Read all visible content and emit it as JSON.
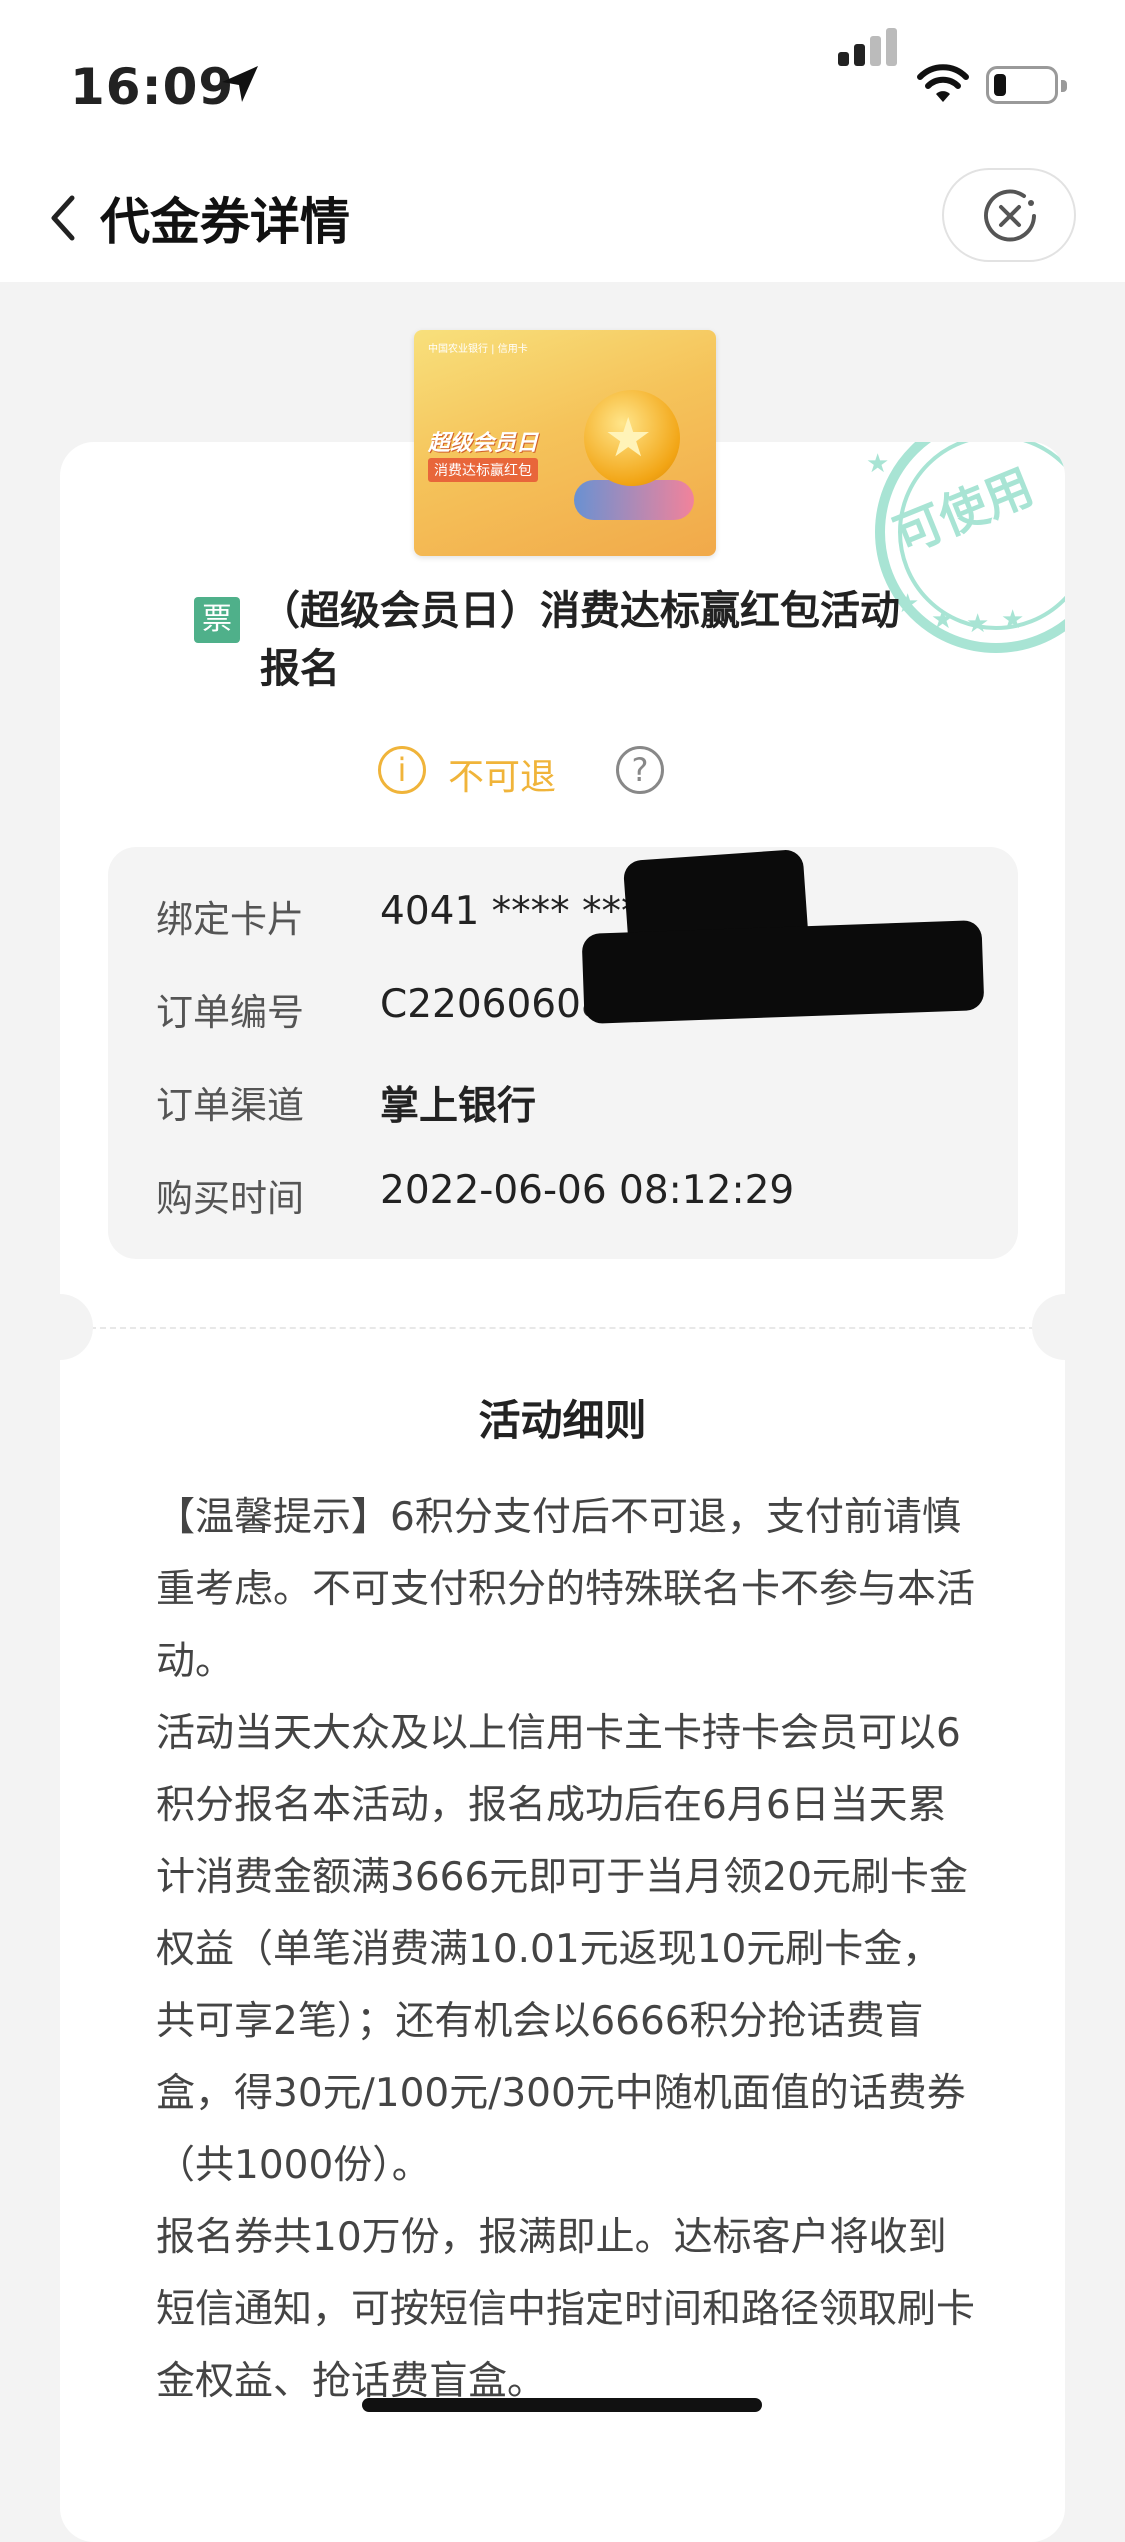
{
  "status": {
    "time": "16:09"
  },
  "nav": {
    "title": "代金券详情"
  },
  "voucher": {
    "stamp_text": "可使用",
    "image": {
      "bank_text": "中国农业银行 | 信用卡",
      "title": "超级会员日",
      "subtitle": "消费达标赢红包"
    },
    "tag": "票",
    "title": "（超级会员日）消费达标赢红包活动报名",
    "refund_text": "不可退"
  },
  "details": [
    {
      "label": "绑定卡片",
      "value": "4041 **** ****"
    },
    {
      "label": "订单编号",
      "value": "C22060608"
    },
    {
      "label": "订单渠道",
      "value": "掌上银行"
    },
    {
      "label": "购买时间",
      "value": "2022-06-06 08:12:29"
    }
  ],
  "rules": {
    "title": "活动细则",
    "paragraphs": [
      "【温馨提示】6积分支付后不可退，支付前请慎重考虑。不可支付积分的特殊联名卡不参与本活动。",
      "活动当天大众及以上信用卡主卡持卡会员可以6积分报名本活动，报名成功后在6月6日当天累计消费金额满3666元即可于当月领20元刷卡金权益（单笔消费满10.01元返现10元刷卡金，共可享2笔）；还有机会以6666积分抢话费盲盒，得30元/100元/300元中随机面值的话费券（共1000份）。",
      "报名券共10万份，报满即止。达标客户将收到短信通知，可按短信中指定时间和路径领取刷卡金权益、抢话费盲盒。"
    ]
  },
  "colors": {
    "accent_green": "#4fb08a",
    "warning_orange": "#f0b43a",
    "stamp_teal": "#8fd8c4"
  }
}
